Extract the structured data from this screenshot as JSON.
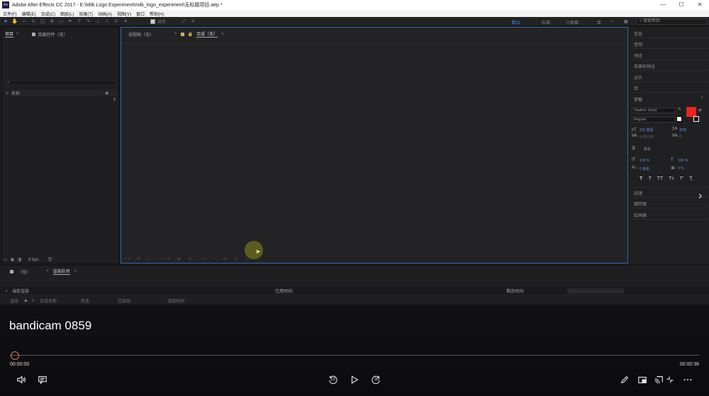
{
  "window": {
    "title": "Adobe After Effects CC 2017 - E:\\Milk Logo Experiment\\milk_logo_experiment\\无标题项目.aep *",
    "logo": "Ae"
  },
  "menu": [
    "文件(F)",
    "编辑(E)",
    "合成(C)",
    "图层(L)",
    "效果(T)",
    "动画(A)",
    "视图(V)",
    "窗口",
    "帮助(H)"
  ],
  "toolbar": {
    "align_label": "对齐",
    "workspaces": [
      "默认",
      "标准",
      "小屏幕",
      "库"
    ],
    "active_workspace": "默认",
    "search_placeholder": "搜索帮助"
  },
  "project_panel": {
    "tab_project": "项目",
    "tab_effects": "效果控件（无）",
    "column_name": "名称",
    "bpc": "8 bpc"
  },
  "comp_panel": {
    "tab_flowchart": "流程图（无）",
    "tab_comp": "合成（无）"
  },
  "right_panel": {
    "items": [
      "信息",
      "音频",
      "预览",
      "效果和预设",
      "对齐",
      "库"
    ],
    "character_title": "字符",
    "font_name": "Vladimir Script",
    "font_style": "Regular",
    "size_value": "201 像素",
    "leading_value": "自动",
    "kerning_value": "度量标准",
    "tracking_value": "0",
    "stroke_value": "像素",
    "vscale": "100 %",
    "hscale": "100 %",
    "baseline": "0 像素",
    "tsume": "0 %",
    "style_buttons": [
      "T",
      "T",
      "TT",
      "Tт",
      "T'",
      "T,"
    ],
    "fill_color": "#e8261f",
    "lower_items": [
      "段落",
      "跟踪器",
      "绘画器"
    ]
  },
  "render_queue": {
    "tab_none": "（无）",
    "tab_queue": "渲染队列",
    "current_render": "当前渲染",
    "elapsed": "已用时间:",
    "remaining": "剩余时间:",
    "columns": [
      "渲染",
      "#",
      "合成名称",
      "状态",
      "已启动",
      "渲染时间"
    ]
  },
  "player": {
    "video_title": "bandicam 0859",
    "time_current": "00:00:00",
    "time_total": "00:00:36",
    "progress_fraction": 0.0,
    "skip_back": "10",
    "skip_forward": "30"
  }
}
